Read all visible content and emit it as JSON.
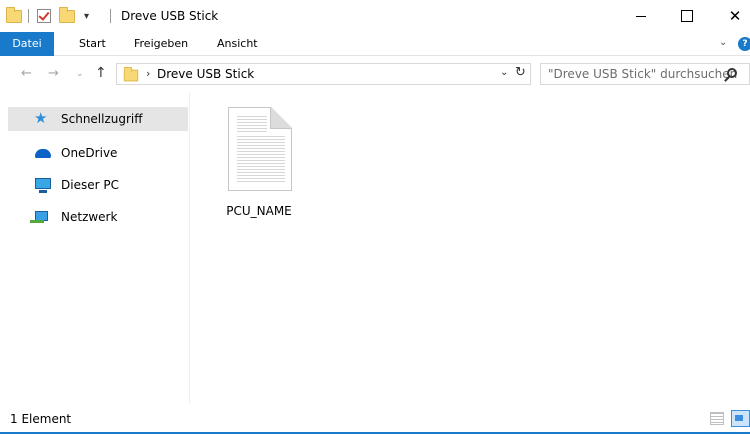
{
  "window": {
    "title": "Dreve USB Stick",
    "qa_dropdown_glyph": "▾",
    "minimize_icon": "minimize-icon",
    "maximize_icon": "maximize-icon",
    "close_glyph": "✕"
  },
  "ribbon": {
    "tabs": [
      {
        "label": "Datei",
        "active": true
      },
      {
        "label": "Start"
      },
      {
        "label": "Freigeben"
      },
      {
        "label": "Ansicht"
      }
    ],
    "expand_glyph": "⌄",
    "help_glyph": "?"
  },
  "navigation": {
    "back_glyph": "←",
    "forward_glyph": "→",
    "recent_glyph": "⌄",
    "up_glyph": "↑",
    "address": {
      "separator": "›",
      "path": "Dreve USB Stick",
      "dropdown_glyph": "⌄",
      "refresh_glyph": "↻"
    },
    "search": {
      "placeholder": "\"Dreve USB Stick\" durchsuchen"
    }
  },
  "sidebar": {
    "items": [
      {
        "label": "Schnellzugriff",
        "icon": "star-icon",
        "selected": true
      },
      {
        "label": "OneDrive",
        "icon": "cloud-icon"
      },
      {
        "label": "Dieser PC",
        "icon": "computer-icon"
      },
      {
        "label": "Netzwerk",
        "icon": "network-icon"
      }
    ]
  },
  "files": [
    {
      "name": "PCU_NAME",
      "icon": "text-document-icon"
    }
  ],
  "statusbar": {
    "count_text": "1 Element",
    "views": [
      "details-view-icon",
      "large-icons-view-icon"
    ]
  },
  "colors": {
    "accent": "#1979ca",
    "folder": "#f8d775",
    "selection": "#e5e5e5"
  }
}
